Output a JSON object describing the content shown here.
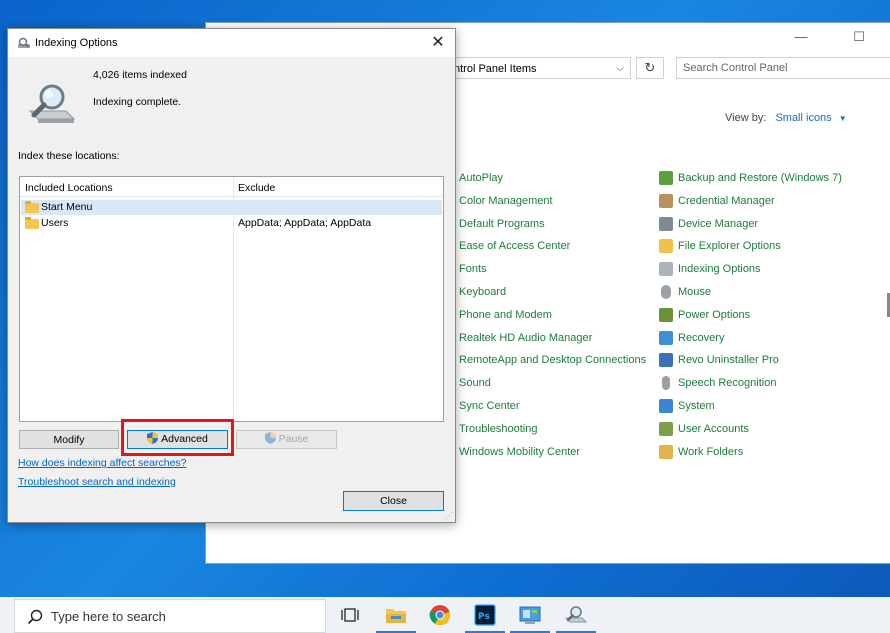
{
  "control_panel": {
    "address": "ntrol Panel Items",
    "search_placeholder": "Search Control Panel",
    "view_by_label": "View by:",
    "view_by_value": "Small icons",
    "column_a": [
      "AutoPlay",
      "Color Management",
      "Default Programs",
      "Ease of Access Center",
      "Fonts",
      "Keyboard",
      "Phone and Modem",
      "Realtek HD Audio Manager",
      "RemoteApp and Desktop Connections",
      "Sound",
      "Sync Center",
      "Troubleshooting",
      "Windows Mobility Center"
    ],
    "column_b": [
      "Backup and Restore (Windows 7)",
      "Credential Manager",
      "Device Manager",
      "File Explorer Options",
      "Indexing Options",
      "Mouse",
      "Power Options",
      "Recovery",
      "Revo Uninstaller Pro",
      "Speech Recognition",
      "System",
      "User Accounts",
      "Work Folders"
    ]
  },
  "dialog": {
    "title": "Indexing Options",
    "items_indexed": "4,026 items indexed",
    "status": "Indexing complete.",
    "locations_label": "Index these locations:",
    "columns": {
      "included": "Included Locations",
      "exclude": "Exclude"
    },
    "rows": [
      {
        "name": "Start Menu",
        "exclude": ""
      },
      {
        "name": "Users",
        "exclude": "AppData; AppData; AppData"
      }
    ],
    "buttons": {
      "modify": "Modify",
      "advanced": "Advanced",
      "pause": "Pause",
      "close": "Close"
    },
    "links": {
      "how": "How does indexing affect searches?",
      "troubleshoot": "Troubleshoot search and indexing"
    }
  },
  "taskbar": {
    "search_placeholder": "Type here to search"
  },
  "colors": {
    "link_green": "#1d7d3a",
    "highlight_red": "#e0161b",
    "selection": "#d9e7f7",
    "desktop_blue": "#0f6fd3"
  }
}
